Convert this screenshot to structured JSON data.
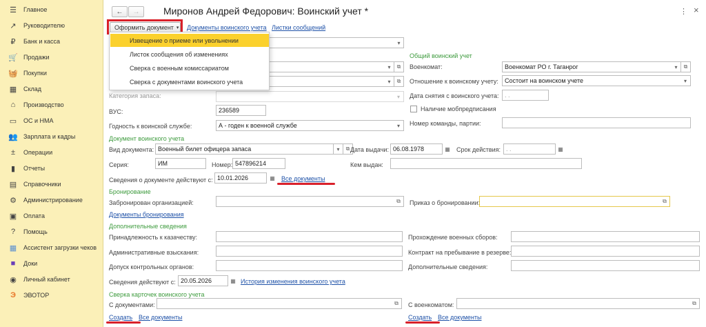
{
  "sidebar": {
    "items": [
      {
        "label": "Главное",
        "icon": "hamburger-icon"
      },
      {
        "label": "Руководителю",
        "icon": "trend-icon"
      },
      {
        "label": "Банк и касса",
        "icon": "ruble-coin-icon"
      },
      {
        "label": "Продажи",
        "icon": "cart-icon"
      },
      {
        "label": "Покупки",
        "icon": "basket-icon"
      },
      {
        "label": "Склад",
        "icon": "warehouse-icon"
      },
      {
        "label": "Производство",
        "icon": "factory-icon"
      },
      {
        "label": "ОС и НМА",
        "icon": "car-icon"
      },
      {
        "label": "Зарплата и кадры",
        "icon": "people-icon"
      },
      {
        "label": "Операции",
        "icon": "operations-icon"
      },
      {
        "label": "Отчеты",
        "icon": "bar-chart-icon"
      },
      {
        "label": "Справочники",
        "icon": "book-icon"
      },
      {
        "label": "Администрирование",
        "icon": "gear-icon"
      },
      {
        "label": "Оплата",
        "icon": "payment-icon"
      },
      {
        "label": "Помощь",
        "icon": "question-icon"
      },
      {
        "label": "Ассистент загрузки чеков",
        "icon": "grid-icon"
      },
      {
        "label": "Доки",
        "icon": "docs-icon"
      },
      {
        "label": "Личный кабинет",
        "icon": "person-icon"
      },
      {
        "label": "ЭВОТОР",
        "icon": "evotor-icon"
      }
    ]
  },
  "header": {
    "title": "Миронов Андрей Федорович: Воинский учет *",
    "back_glyph": "←",
    "forward_glyph": "→",
    "more_glyph": "⋮",
    "close_glyph": "×"
  },
  "toolbar": {
    "make_doc": "Оформить документ",
    "dropdown_arrow": "▾",
    "links": [
      "Документы воинского учета",
      "Листки сообщений"
    ]
  },
  "menu": {
    "items": [
      "Извещение о приеме или увольнении",
      "Листок сообщения об изменениях",
      "Сверка с военным комиссариатом",
      "Сверка с документами воинского учета"
    ]
  },
  "left": {
    "field1_value": "нт",
    "field2_value": ")",
    "category_label": "Категория запаса:",
    "vus_label": "ВУС:",
    "vus_value": "236589",
    "fitness_label": "Годность к воинской службе:",
    "fitness_value": "А - годен к военной службе"
  },
  "general": {
    "section": "Общий воинский учет",
    "voenkomat_label": "Военкомат:",
    "voenkomat_value": "Военкомат РО г. Таганрог",
    "relation_label": "Отношение к воинскому учету:",
    "relation_value": "Состоит на воинском учете",
    "removal_label": "Дата снятия с воинского учета:",
    "removal_value": ". .",
    "mobpred_label": "Наличие мобпредписания",
    "team_label": "Номер команды, партии:"
  },
  "document": {
    "section": "Документ воинского учета",
    "kind_label": "Вид документа:",
    "kind_value": "Военный билет офицера запаса",
    "issue_label": "Дата выдачи:",
    "issue_value": "06.08.1978",
    "valid_label": "Срок действия:",
    "valid_value": ". .",
    "series_label": "Серия:",
    "series_value": "ИМ",
    "number_label": "Номер:",
    "number_value": "547896214",
    "issuer_label": "Кем выдан:",
    "effective_label": "Сведения о документе действуют с:",
    "effective_value": "10.01.2026",
    "all_docs": "Все документы"
  },
  "booking": {
    "section": "Бронирование",
    "org_label": "Забронирован организацией:",
    "order_label": "Приказ о бронировании:",
    "docs_link": "Документы бронирования"
  },
  "extra": {
    "section": "Дополнительные сведения",
    "cossack_label": "Принадлежность к казачеству:",
    "admin_label": "Административные взыскания:",
    "control_label": "Допуск контрольных органов:",
    "training_label": "Прохождение военных сборов:",
    "reserve_label": "Контракт на пребывание в резерве:",
    "additional_label": "Дополнительные сведения:",
    "effective_label": "Сведения действуют с:",
    "effective_value": "20.05.2026",
    "history_link": "История изменения воинского учета"
  },
  "reconcile": {
    "section": "Сверка карточек воинского учета",
    "docs_label": "С документами:",
    "voenkomat_label": "С военкоматом:",
    "create": "Создать",
    "all_docs": "Все документы"
  },
  "colors": {
    "sidebar_bg": "#fbf0b8",
    "menu_active": "#fbd12d",
    "section_green": "#3e9b3e",
    "link_blue": "#1f52a8",
    "highlight_red": "#d9202a"
  }
}
